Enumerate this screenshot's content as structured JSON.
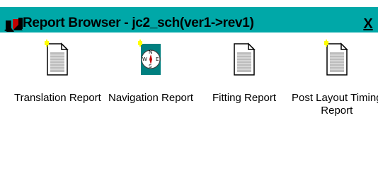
{
  "window": {
    "title": "Report Browser - jc2_sch(ver1->rev1)",
    "close_label": "X"
  },
  "reports": [
    {
      "label": "Translation Report",
      "icon": "document-icon"
    },
    {
      "label": "Navigation Report",
      "icon": "compass-icon"
    },
    {
      "label": "Fitting Report",
      "icon": "document-icon"
    },
    {
      "label_line1": "Post Layout Timing",
      "label_line2": "Report",
      "icon": "document-icon"
    }
  ],
  "colors": {
    "titlebar": "#00a8a8",
    "folded_corner_accent": "#ffff00",
    "compass_bg": "#008080"
  }
}
